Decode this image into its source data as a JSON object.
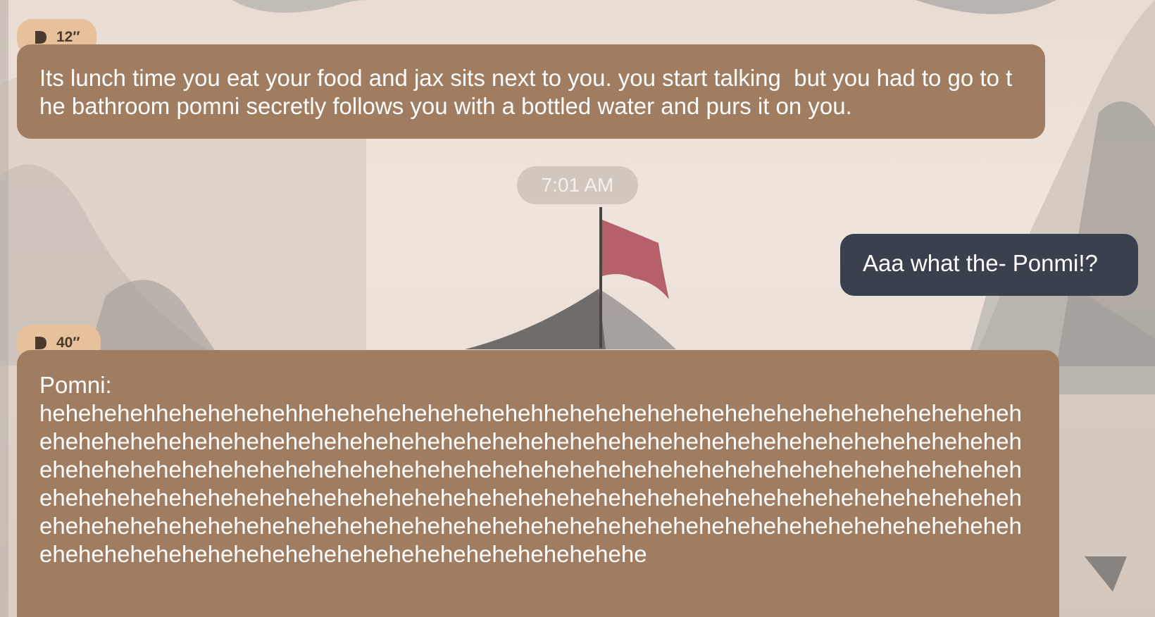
{
  "messages": [
    {
      "sender": "ai",
      "audio_duration": "12″",
      "text": "Its lunch time you eat your food and jax sits next to you. you start talking  but you had to go to the bathroom pomni secretly follows you with a bottled water and purs it on you."
    },
    {
      "type": "timestamp",
      "text": "7:01 AM"
    },
    {
      "sender": "user",
      "text": "Aaa what the- Ponmi!?"
    },
    {
      "sender": "ai",
      "audio_duration": "40″",
      "speaker": "Pomni:",
      "text": "hehehehehhehehehehehhehehehehehehehehehhehehehehehehehehehehehehehehehehehehehehehehehehehehehehehehehehehehehehehehehehehehehehehehehehehehehehehehehehehehehehehehehehehehehehehehehehehehehehehehehehehehehehehehehehehehehehehehehehehehehehehehehehehehehehehehehehehehehehehehehehehehehehehehehehehehehehehehehehehehehehehehehehehehehehehehehehehehehehehehehehehehehehehehehehehehehehehehehehehehehehehehehehehehehehehehehehehe"
    }
  ],
  "icons": {
    "play": "play-icon"
  },
  "colors": {
    "ai_bubble": "#a07c61",
    "user_bubble": "#3a404e",
    "audio_pill": "#e6c19b",
    "timestamp_pill": "#c8beb6"
  }
}
